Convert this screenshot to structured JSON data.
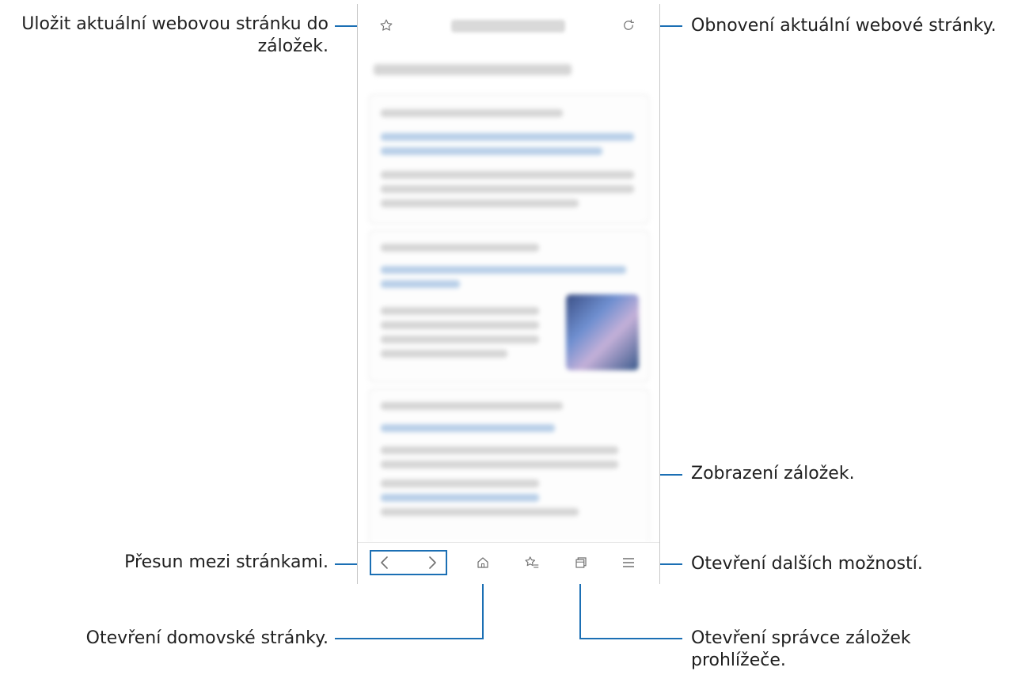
{
  "callouts": {
    "bookmark_save": "Uložit aktuální webovou stránku do",
    "bookmark_save_line2": "záložek.",
    "refresh": "Obnovení aktuální webové stránky.",
    "show_bookmarks": "Zobrazení záložek.",
    "page_navigation": "Přesun mezi stránkami.",
    "more_options": "Otevření dalších možností.",
    "home_page": "Otevření domovské stránky.",
    "tab_manager": "Otevření správce záložek",
    "tab_manager_line2": "prohlížeče."
  },
  "colors": {
    "leader": "#1b6fb4",
    "icon": "#707070"
  },
  "icons": {
    "add_bookmark": "star-outline-icon",
    "refresh": "refresh-icon",
    "back": "chevron-left-icon",
    "forward": "chevron-right-icon",
    "home": "home-icon",
    "bookmarks": "star-list-icon",
    "tabs": "tabs-icon",
    "menu": "hamburger-menu-icon"
  }
}
